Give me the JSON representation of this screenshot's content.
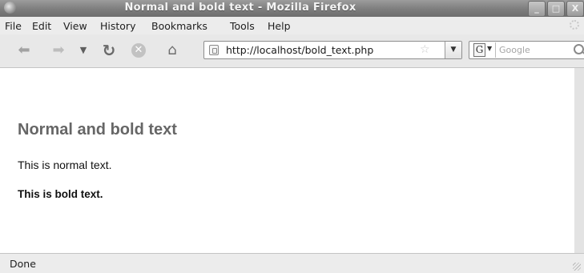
{
  "window": {
    "title": "Normal and bold text - Mozilla Firefox",
    "buttons": [
      "_",
      "□",
      "X"
    ]
  },
  "menubar": {
    "items": [
      "File",
      "Edit",
      "View",
      "History",
      "Bookmarks",
      "Tools",
      "Help"
    ]
  },
  "toolbar": {
    "icons": [
      "back-icon",
      "forward-icon",
      "history-dropdown-icon",
      "reload-icon",
      "stop-icon",
      "home-icon"
    ],
    "url": "http://localhost/bold_text.php",
    "search_engine": "G",
    "search_placeholder": "Google"
  },
  "page": {
    "heading": "Normal and bold text",
    "normal_text": "This is normal text.",
    "bold_text": "This is bold text."
  },
  "statusbar": {
    "status": "Done"
  }
}
